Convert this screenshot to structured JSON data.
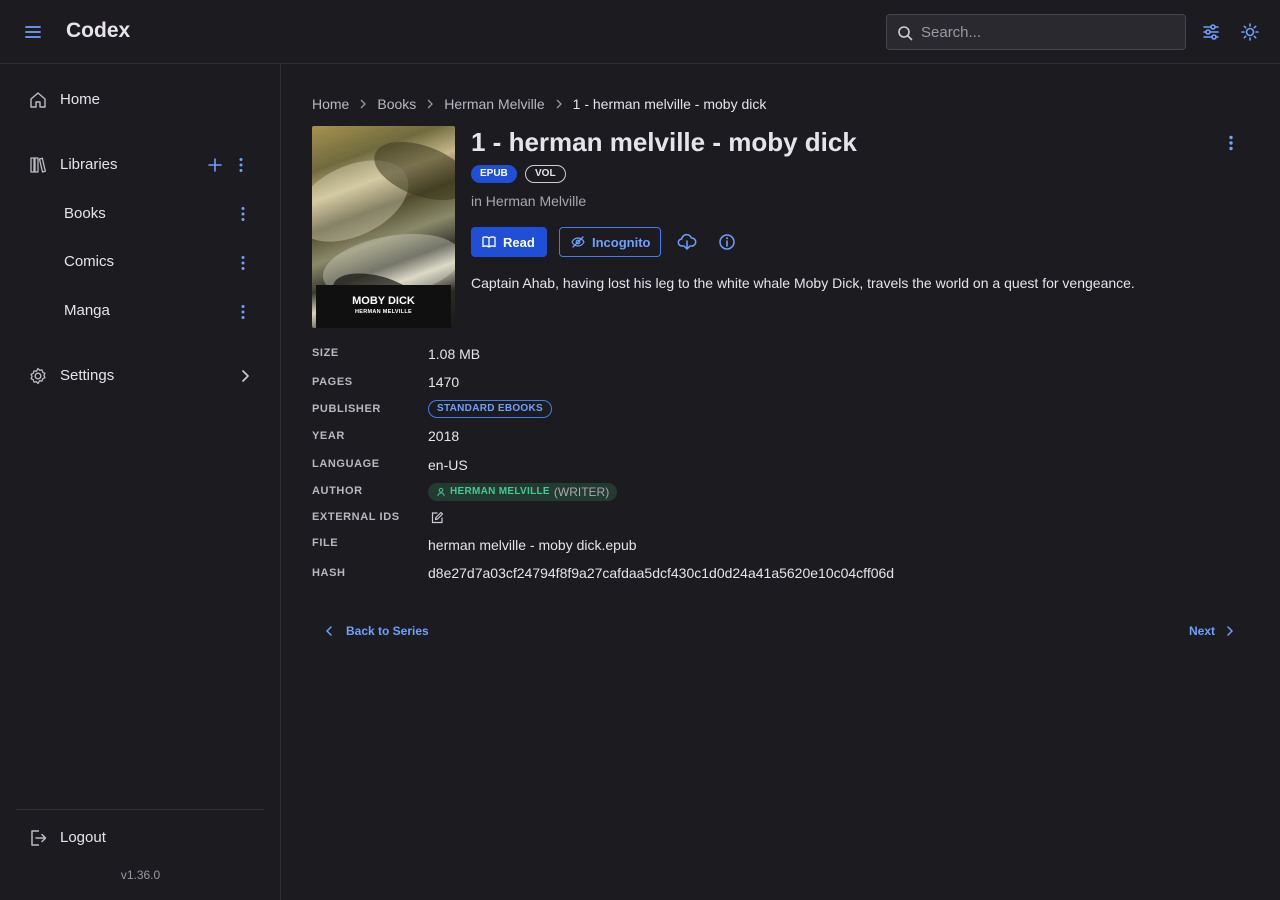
{
  "app": {
    "title": "Codex",
    "version": "v1.36.0",
    "accent_color": "#1f4fd6",
    "link_color": "#6ea0ff"
  },
  "header": {
    "search_placeholder": "Search...",
    "icons": [
      "menu-icon",
      "search-icon",
      "filter-sliders-icon",
      "theme-sun-icon"
    ]
  },
  "sidebar": {
    "home_label": "Home",
    "libraries_label": "Libraries",
    "libraries": [
      {
        "label": "Books"
      },
      {
        "label": "Comics"
      },
      {
        "label": "Manga"
      }
    ],
    "settings_label": "Settings",
    "logout_label": "Logout"
  },
  "breadcrumb": [
    {
      "label": "Home"
    },
    {
      "label": "Books"
    },
    {
      "label": "Herman Melville"
    },
    {
      "label": "1 - herman melville - moby dick"
    }
  ],
  "book": {
    "title": "1 - herman melville - moby dick",
    "format_badge": "EPUB",
    "type_badge": "VOL",
    "series_prefix": "in ",
    "series_name": "Herman Melville",
    "cover_title": "MOBY DICK",
    "cover_author": "HERMAN MELVILLE",
    "summary": "Captain Ahab, having lost his leg to the white whale Moby Dick, travels the world on a quest for vengeance."
  },
  "actions": {
    "read_label": "Read",
    "incognito_label": "Incognito"
  },
  "metadata": {
    "size_label": "SIZE",
    "size_value": "1.08 MB",
    "pages_label": "PAGES",
    "pages_value": "1470",
    "publisher_label": "PUBLISHER",
    "publisher_value": "STANDARD EBOOKS",
    "year_label": "YEAR",
    "year_value": "2018",
    "language_label": "LANGUAGE",
    "language_value": "en-US",
    "author_label": "AUTHOR",
    "author_name": "HERMAN MELVILLE",
    "author_role": "(WRITER)",
    "external_ids_label": "EXTERNAL IDS",
    "file_label": "FILE",
    "file_value": "herman melville - moby dick.epub",
    "hash_label": "HASH",
    "hash_value": "d8e27d7a03cf24794f8f9a27cafdaa5dcf430c1d0d24a41a5620e10c04cff06d"
  },
  "footer_nav": {
    "back_label": "Back to Series",
    "next_label": "Next"
  }
}
